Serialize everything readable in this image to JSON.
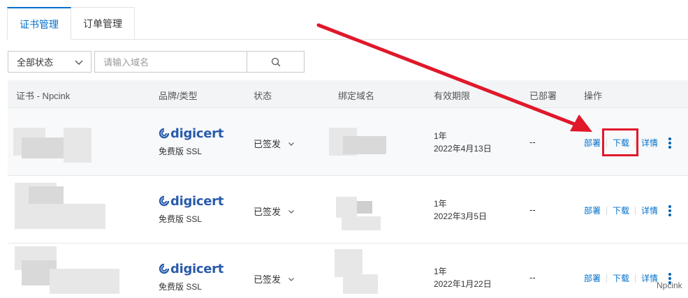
{
  "tabs": [
    {
      "label": "证书管理",
      "active": true
    },
    {
      "label": "订单管理",
      "active": false
    }
  ],
  "filter": {
    "status_select": "全部状态",
    "search_placeholder": "请输入域名"
  },
  "table": {
    "headers": {
      "cert": "证书 - Npcink",
      "brand": "品牌/类型",
      "status": "状态",
      "domain": "绑定域名",
      "validity": "有效期限",
      "deployed": "已部署",
      "ops": "操作"
    },
    "rows": [
      {
        "brand": "digicert",
        "type": "免费版 SSL",
        "status": "已签发",
        "period": "1年",
        "expire": "2022年4月13日",
        "deployed": "--",
        "deploy": "部署",
        "download": "下载",
        "detail": "详情",
        "highlighted": true
      },
      {
        "brand": "digicert",
        "type": "免费版 SSL",
        "status": "已签发",
        "period": "1年",
        "expire": "2022年3月5日",
        "deployed": "--",
        "deploy": "部署",
        "download": "下载",
        "detail": "详情",
        "highlighted": false
      },
      {
        "brand": "digicert",
        "type": "免费版 SSL",
        "status": "已签发",
        "period": "1年",
        "expire": "2022年1月22日",
        "deployed": "--",
        "deploy": "部署",
        "download": "下载",
        "detail": "详情",
        "highlighted": false
      }
    ]
  },
  "watermark": "Npcink",
  "colors": {
    "accent": "#0070cc",
    "annotation": "#e0182a",
    "brand": "#2a5bab"
  }
}
